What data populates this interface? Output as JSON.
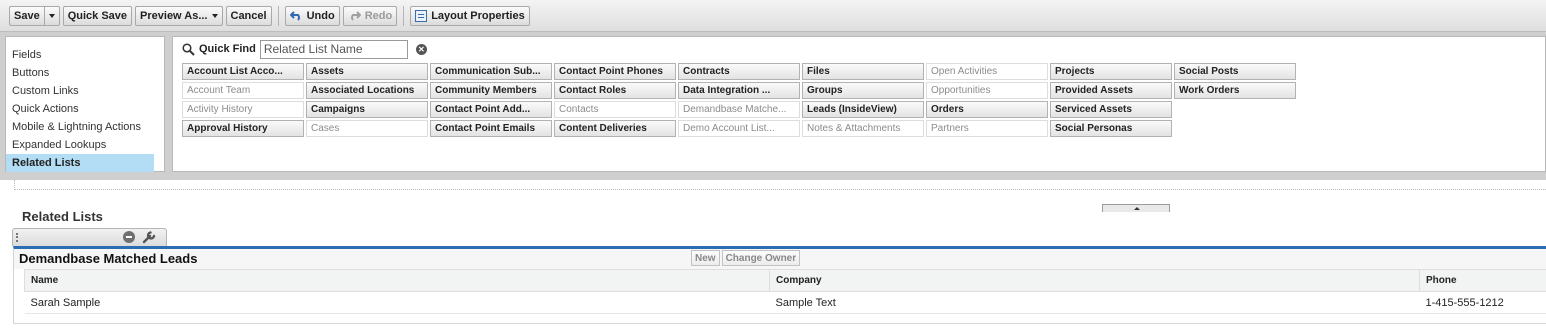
{
  "toolbar": {
    "save": "Save",
    "quick_save": "Quick Save",
    "preview_as": "Preview As...",
    "cancel": "Cancel",
    "undo": "Undo",
    "redo": "Redo",
    "layout_properties": "Layout Properties"
  },
  "palette": {
    "categories": [
      "Fields",
      "Buttons",
      "Custom Links",
      "Quick Actions",
      "Mobile & Lightning Actions",
      "Expanded Lookups",
      "Related Lists"
    ],
    "selected_category": "Related Lists",
    "quick_find": {
      "label": "Quick Find",
      "placeholder": "Related List Name"
    },
    "items": [
      {
        "label": "Account List Acco...",
        "used": false
      },
      {
        "label": "Account Team",
        "used": true
      },
      {
        "label": "Activity History",
        "used": true
      },
      {
        "label": "Approval History",
        "used": false
      },
      {
        "label": "Assets",
        "used": false
      },
      {
        "label": "Associated Locations",
        "used": false
      },
      {
        "label": "Campaigns",
        "used": false
      },
      {
        "label": "Cases",
        "used": true
      },
      {
        "label": "Communication Sub...",
        "used": false
      },
      {
        "label": "Community Members",
        "used": false
      },
      {
        "label": "Contact Point Add...",
        "used": false
      },
      {
        "label": "Contact Point Emails",
        "used": false
      },
      {
        "label": "Contact Point Phones",
        "used": false
      },
      {
        "label": "Contact Roles",
        "used": false
      },
      {
        "label": "Contacts",
        "used": true
      },
      {
        "label": "Content Deliveries",
        "used": false
      },
      {
        "label": "Contracts",
        "used": false
      },
      {
        "label": "Data Integration ...",
        "used": false
      },
      {
        "label": "Demandbase Matche...",
        "used": true
      },
      {
        "label": "Demo Account List...",
        "used": true
      },
      {
        "label": "Files",
        "used": false
      },
      {
        "label": "Groups",
        "used": false
      },
      {
        "label": "Leads (InsideView)",
        "used": false
      },
      {
        "label": "Notes & Attachments",
        "used": true
      },
      {
        "label": "Open Activities",
        "used": true
      },
      {
        "label": "Opportunities",
        "used": true
      },
      {
        "label": "Orders",
        "used": false
      },
      {
        "label": "Partners",
        "used": true
      },
      {
        "label": "Projects",
        "used": false
      },
      {
        "label": "Provided Assets",
        "used": false
      },
      {
        "label": "Serviced Assets",
        "used": false
      },
      {
        "label": "Social Personas",
        "used": false
      },
      {
        "label": "Social Posts",
        "used": false
      },
      {
        "label": "Work Orders",
        "used": false
      }
    ]
  },
  "canvas": {
    "section_title": "Related Lists",
    "related_list": {
      "name": "Demandbase Matched Leads",
      "buttons": [
        "New",
        "Change Owner"
      ],
      "columns": [
        "Name",
        "Company",
        "Phone"
      ],
      "rows": [
        [
          "Sarah Sample",
          "Sample Text",
          "1-415-555-1212"
        ]
      ]
    }
  },
  "colors": {
    "accent_blue": "#2b6db5",
    "selected_bg": "#b3dcf5"
  }
}
